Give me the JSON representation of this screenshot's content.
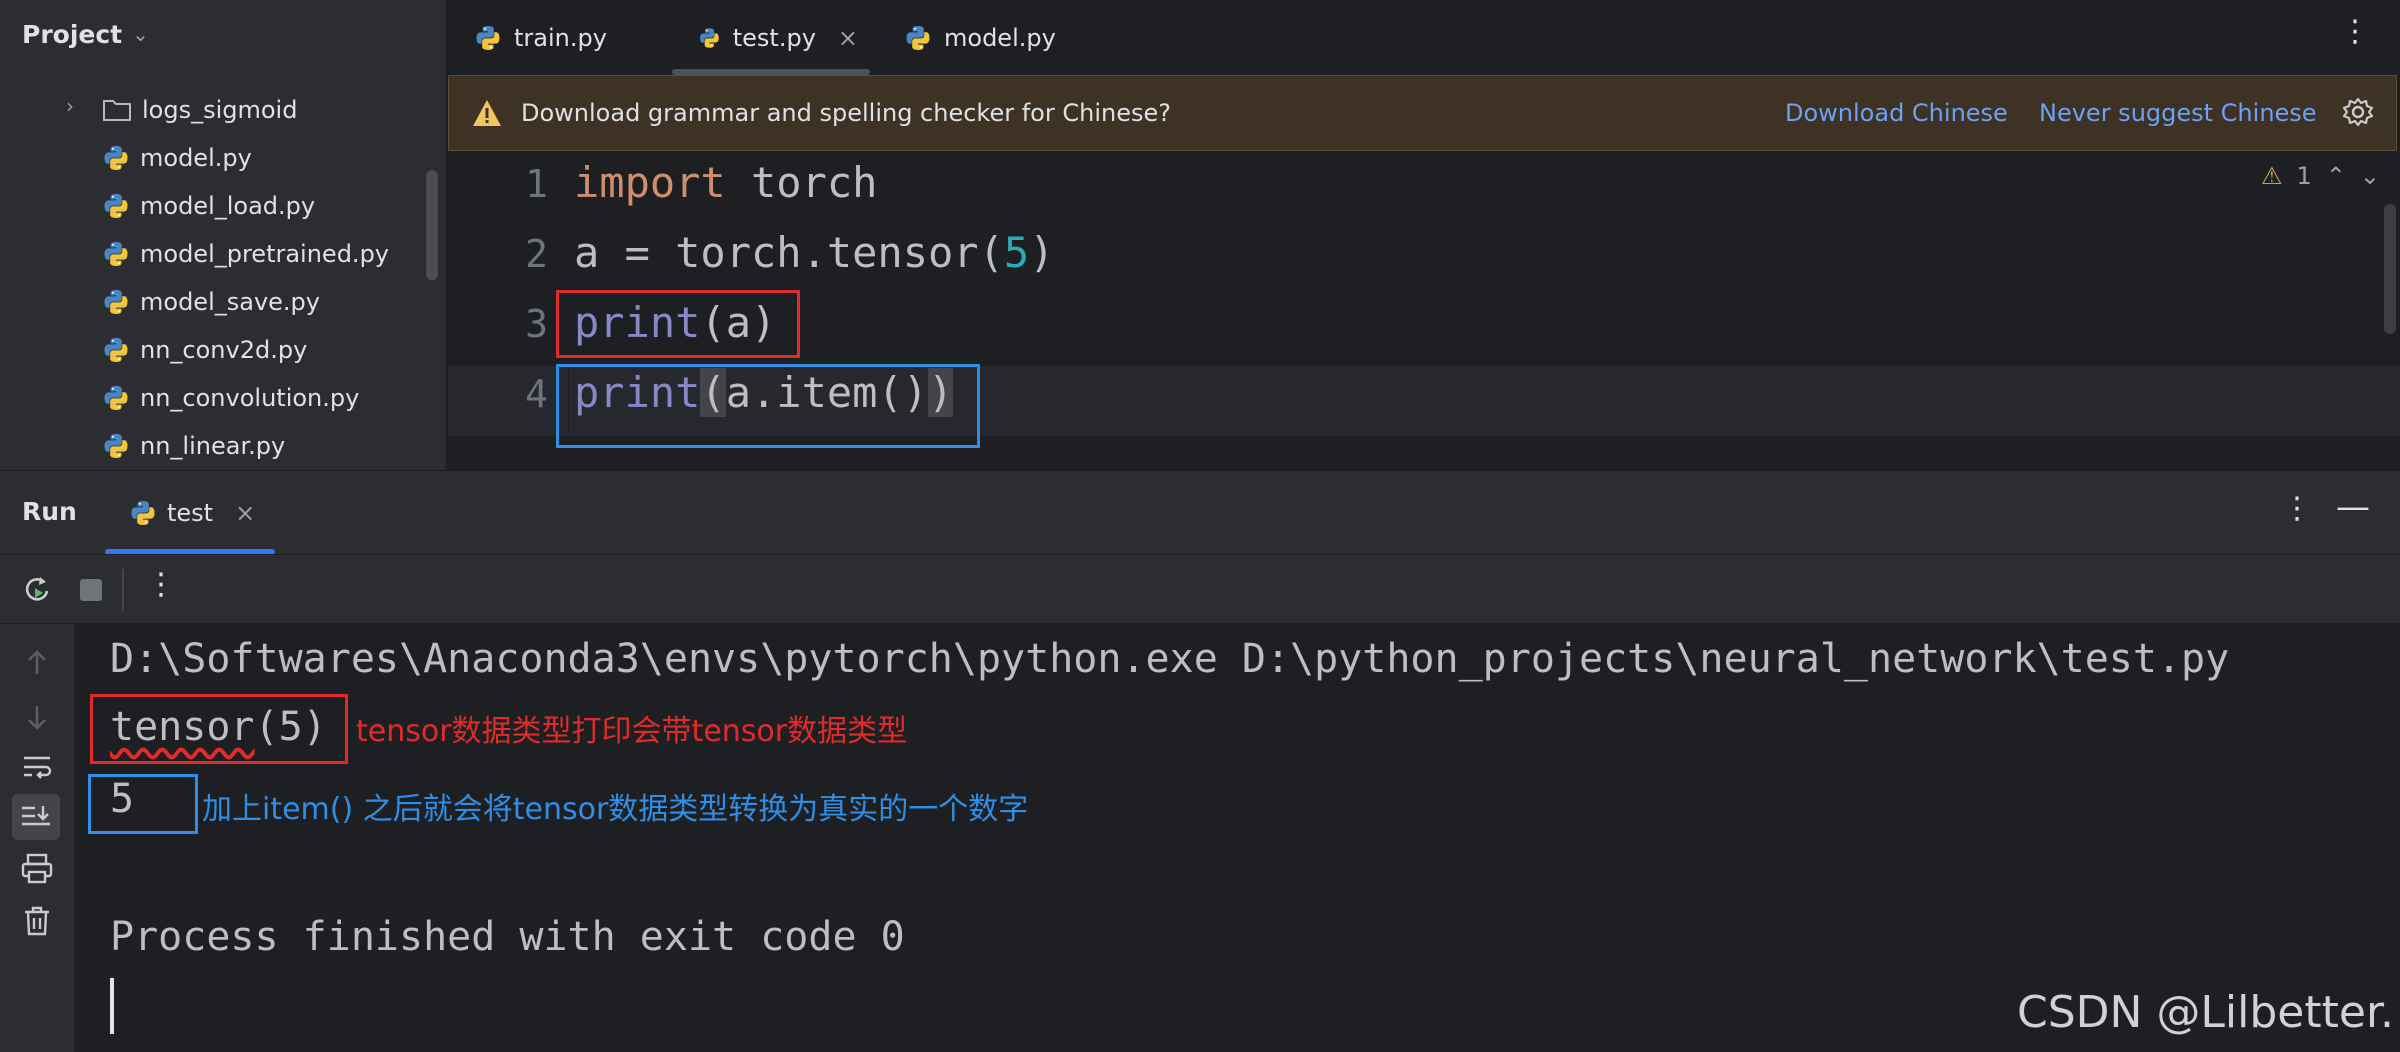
{
  "project": {
    "title": "Project",
    "items": [
      {
        "label": "logs_sigmoid",
        "type": "folder"
      },
      {
        "label": "model.py",
        "type": "python"
      },
      {
        "label": "model_load.py",
        "type": "python"
      },
      {
        "label": "model_pretrained.py",
        "type": "python"
      },
      {
        "label": "model_save.py",
        "type": "python"
      },
      {
        "label": "nn_conv2d.py",
        "type": "python"
      },
      {
        "label": "nn_convolution.py",
        "type": "python"
      },
      {
        "label": "nn_linear.py",
        "type": "python"
      }
    ]
  },
  "editor_tabs": [
    {
      "label": "train.py",
      "active": false
    },
    {
      "label": "test.py",
      "active": true
    },
    {
      "label": "model.py",
      "active": false
    }
  ],
  "banner": {
    "message": "Download grammar and spelling checker for Chinese?",
    "action_primary": "Download Chinese",
    "action_secondary": "Never suggest Chinese"
  },
  "editor": {
    "line_numbers": [
      "1",
      "2",
      "3",
      "4"
    ],
    "lines": [
      {
        "kw": "import",
        "rest": " torch"
      },
      {
        "pre": "a = torch.tensor(",
        "num": "5",
        "post": ")"
      },
      {
        "fn": "print",
        "rest": "(a)"
      },
      {
        "fn": "print",
        "open": "(",
        "mid": "a.item()",
        "close": ")"
      }
    ],
    "warning_count": "1"
  },
  "run": {
    "title": "Run",
    "tab_label": "test",
    "console": {
      "command": "D:\\Softwares\\Anaconda3\\envs\\pytorch\\python.exe D:\\python_projects\\neural_network\\test.py",
      "output_1_fn": "tensor",
      "output_1_rest": "(5)",
      "output_2": "5",
      "finish": "Process finished with exit code 0"
    },
    "annotations": {
      "red_note": "tensor数据类型打印会带tensor数据类型",
      "blue_note": "加上item() 之后就会将tensor数据类型转换为真实的一个数字"
    }
  },
  "watermark": "CSDN @Lilbetter.",
  "colors": {
    "accent": "#3574f0",
    "annotation_red": "#e12a2a",
    "annotation_blue": "#2f8ee6",
    "keyword": "#cf8e6d",
    "builtin": "#8888c6",
    "number": "#2aacb8"
  }
}
